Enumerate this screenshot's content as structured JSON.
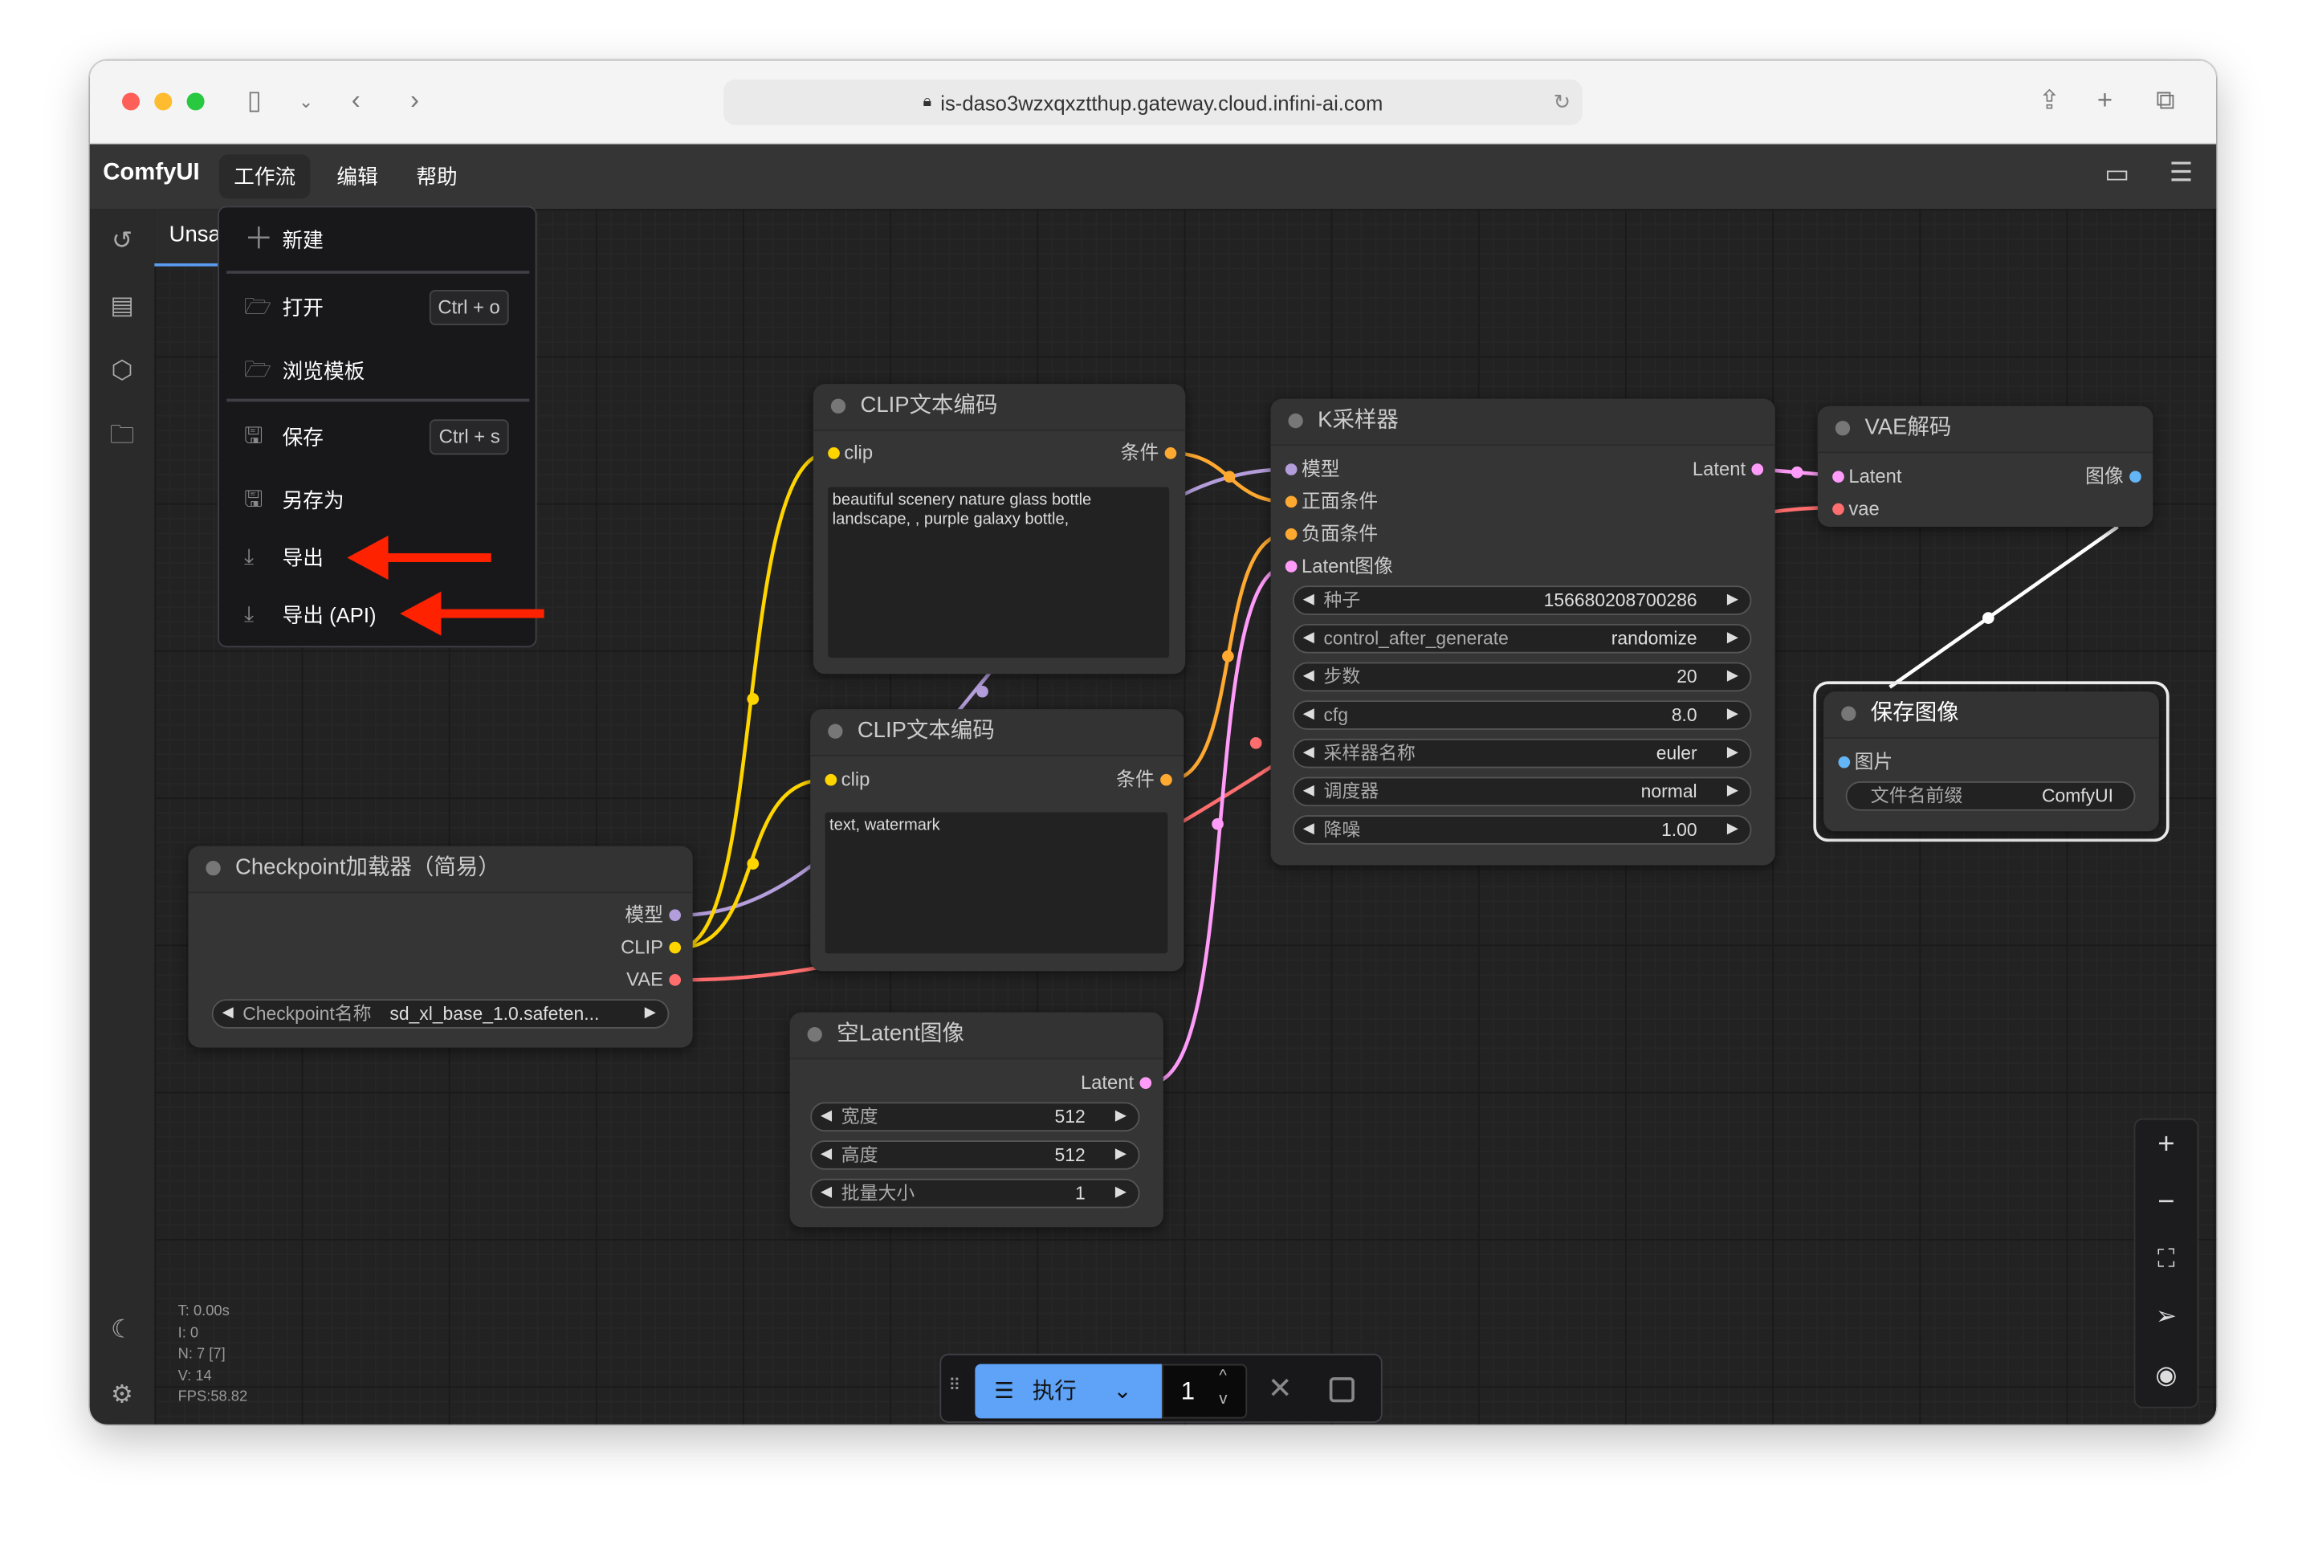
{
  "browser": {
    "url": "is-daso3wzxqxztthup.gateway.cloud.infini-ai.com"
  },
  "app": {
    "name": "ComfyUI",
    "menus": [
      "工作流",
      "编辑",
      "帮助"
    ],
    "tab": "Unsa"
  },
  "workflow_menu": {
    "items": [
      {
        "label": "新建",
        "icon": "plus-icon"
      },
      {
        "label": "打开",
        "icon": "folder-open-icon",
        "shortcut": "Ctrl + o"
      },
      {
        "label": "浏览模板",
        "icon": "folder-open-icon"
      },
      {
        "label": "保存",
        "icon": "save-icon",
        "shortcut": "Ctrl + s"
      },
      {
        "label": "另存为",
        "icon": "save-icon"
      },
      {
        "label": "导出",
        "icon": "download-icon"
      },
      {
        "label": "导出 (API)",
        "icon": "download-icon"
      }
    ]
  },
  "nodes": {
    "clip1": {
      "title": "CLIP文本编码",
      "input": "clip",
      "output": "条件",
      "text": "beautiful scenery nature glass bottle landscape, , purple galaxy bottle,"
    },
    "clip2": {
      "title": "CLIP文本编码",
      "input": "clip",
      "output": "条件",
      "text": "text, watermark"
    },
    "checkpoint": {
      "title": "Checkpoint加载器（简易）",
      "outputs": [
        "模型",
        "CLIP",
        "VAE"
      ],
      "widget_label": "Checkpoint名称",
      "widget_value": "sd_xl_base_1.0.safeten..."
    },
    "latent": {
      "title": "空Latent图像",
      "output": "Latent",
      "widgets": [
        {
          "label": "宽度",
          "value": "512"
        },
        {
          "label": "高度",
          "value": "512"
        },
        {
          "label": "批量大小",
          "value": "1"
        }
      ]
    },
    "ksampler": {
      "title": "K采样器",
      "inputs": [
        "模型",
        "正面条件",
        "负面条件",
        "Latent图像"
      ],
      "output": "Latent",
      "widgets": [
        {
          "label": "种子",
          "value": "156680208700286"
        },
        {
          "label": "control_after_generate",
          "value": "randomize"
        },
        {
          "label": "步数",
          "value": "20"
        },
        {
          "label": "cfg",
          "value": "8.0"
        },
        {
          "label": "采样器名称",
          "value": "euler"
        },
        {
          "label": "调度器",
          "value": "normal"
        },
        {
          "label": "降噪",
          "value": "1.00"
        }
      ]
    },
    "vae": {
      "title": "VAE解码",
      "inputs": [
        "Latent",
        "vae"
      ],
      "output": "图像"
    },
    "save": {
      "title": "保存图像",
      "input": "图片",
      "widget_label": "文件名前缀",
      "widget_value": "ComfyUI"
    }
  },
  "stats": {
    "t": "T: 0.00s",
    "i": "I: 0",
    "n": "N: 7 [7]",
    "v": "V: 14",
    "fps": "FPS:58.82"
  },
  "runbar": {
    "run_label": "执行",
    "batch_count": "1"
  },
  "colors": {
    "accent": "#5a9cf0",
    "model": "#b39ddb",
    "clip": "#ffd500",
    "vae": "#ff6e6e",
    "conditioning": "#ffa931",
    "latent": "#ff9cf9",
    "image": "#64b5f6",
    "annotation_arrow": "#ff2200"
  }
}
